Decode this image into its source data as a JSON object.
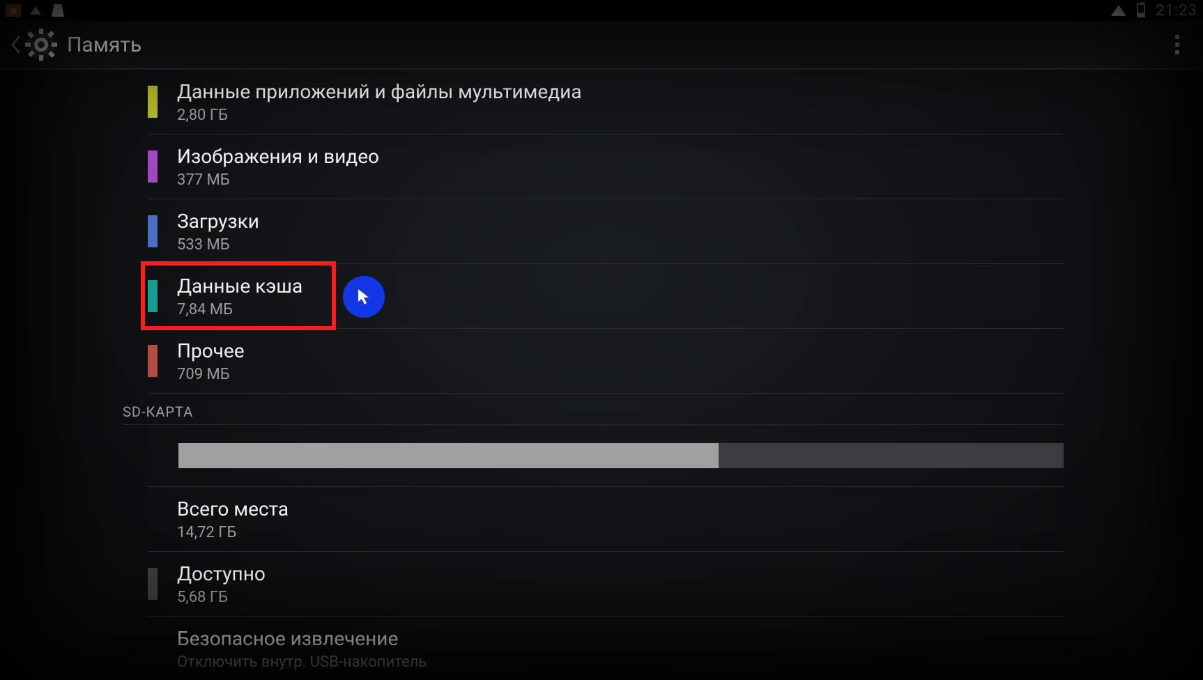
{
  "status": {
    "time": "21:23"
  },
  "appbar": {
    "title": "Память"
  },
  "storage": {
    "items": [
      {
        "label": "Данные приложений и файлы мультимедиа",
        "size": "2,80 ГБ",
        "color": "#b7b92f"
      },
      {
        "label": "Изображения и видео",
        "size": "377 МБ",
        "color": "#a247c4"
      },
      {
        "label": "Загрузки",
        "size": "533 МБ",
        "color": "#4a6fc2"
      },
      {
        "label": "Данные кэша",
        "size": "7,84 МБ",
        "color": "#159e91"
      },
      {
        "label": "Прочее",
        "size": "709 МБ",
        "color": "#b34c3e"
      }
    ]
  },
  "sd": {
    "header": "SD-КАРТА",
    "usage_percent": 61,
    "total_label": "Всего места",
    "total_value": "14,72 ГБ",
    "avail_label": "Доступно",
    "avail_value": "5,68 ГБ",
    "eject_label": "Безопасное извлечение",
    "eject_sub": "Отключить внутр. USB-накопитель"
  },
  "annotation": {
    "highlight_index": 3
  }
}
